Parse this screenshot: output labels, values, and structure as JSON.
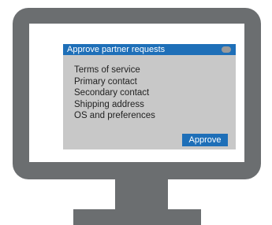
{
  "dialog": {
    "title": "Approve partner requests",
    "items": [
      {
        "label": "Terms of service"
      },
      {
        "label": "Primary contact"
      },
      {
        "label": "Secondary contact"
      },
      {
        "label": "Shipping address"
      },
      {
        "label": "OS and preferences"
      }
    ],
    "approve_label": "Approve"
  },
  "colors": {
    "accent": "#1e6fb8",
    "dialog_background": "#c8c8c8",
    "monitor": "#6b6e70"
  },
  "icons": {
    "window_button": "pill-button-icon"
  }
}
